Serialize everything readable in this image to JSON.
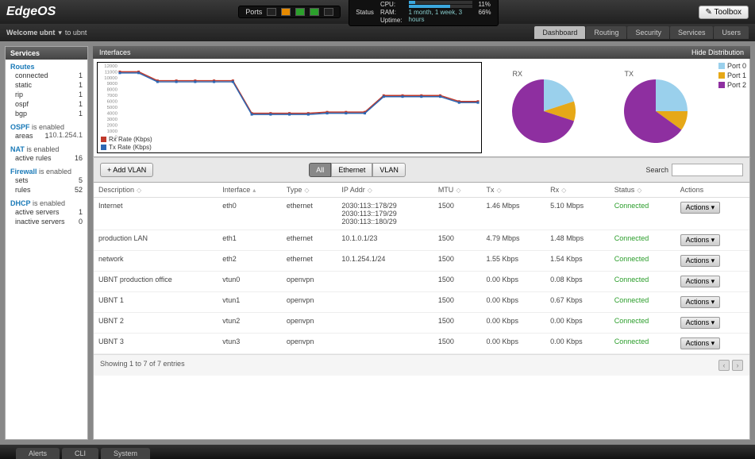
{
  "app": {
    "name": "EdgeOS"
  },
  "topbar": {
    "ports_label": "Ports",
    "status_label": "Status",
    "cpu_label": "CPU:",
    "cpu_pct": 11,
    "cpu_pct_text": "11%",
    "ram_label": "RAM:",
    "ram_pct": 66,
    "ram_pct_text": "66%",
    "uptime_label": "Uptime:",
    "uptime_value": "1 month, 1 week, 3 hours",
    "toolbox_label": "Toolbox"
  },
  "welcome": {
    "text": "Welcome ubnt",
    "sep": "▾",
    "to": "to ubnt"
  },
  "nav_tabs": [
    "Dashboard",
    "Routing",
    "Security",
    "Services",
    "Users"
  ],
  "nav_active": 0,
  "sidebar": {
    "title": "Services",
    "groups": [
      {
        "title": "Routes",
        "title_plain": true,
        "items": [
          {
            "k": "connected",
            "v": "1"
          },
          {
            "k": "static",
            "v": "1"
          },
          {
            "k": "rip",
            "v": "1"
          },
          {
            "k": "ospf",
            "v": "1"
          },
          {
            "k": "bgp",
            "v": "1"
          }
        ]
      },
      {
        "title": "OSPF",
        "suffix": "is enabled",
        "extra": "10.1.254.1",
        "items": [
          {
            "k": "areas",
            "v": "1"
          }
        ]
      },
      {
        "title": "NAT",
        "suffix": "is enabled",
        "items": [
          {
            "k": "active rules",
            "v": "16"
          }
        ]
      },
      {
        "title": "Firewall",
        "suffix": "is enabled",
        "items": [
          {
            "k": "sets",
            "v": "5"
          },
          {
            "k": "rules",
            "v": "52"
          }
        ]
      },
      {
        "title": "DHCP",
        "suffix": "is enabled",
        "items": [
          {
            "k": "active servers",
            "v": "1"
          },
          {
            "k": "inactive servers",
            "v": "0"
          }
        ]
      }
    ]
  },
  "interfaces_hdr": {
    "title": "Interfaces",
    "link": "Hide Distribution"
  },
  "chart_data": {
    "line": {
      "type": "line",
      "title": "",
      "xlabel": "",
      "ylabel": "",
      "ylim": [
        0,
        12000
      ],
      "yticks": [
        0,
        1000,
        2000,
        3000,
        4000,
        5000,
        6000,
        7000,
        8000,
        9000,
        10000,
        11000,
        12000
      ],
      "series": [
        {
          "name": "Rx Rate (Kbps)",
          "color": "#c0392b",
          "values": [
            11000,
            11000,
            9500,
            9500,
            9500,
            9500,
            9500,
            4000,
            4000,
            4000,
            4000,
            4200,
            4200,
            4200,
            7000,
            7000,
            7000,
            7000,
            6000,
            6000
          ]
        },
        {
          "name": "Tx Rate (Kbps)",
          "color": "#2c67b3",
          "values": [
            10800,
            10800,
            9300,
            9300,
            9300,
            9300,
            9300,
            3800,
            3800,
            3800,
            3800,
            4000,
            4000,
            4000,
            6800,
            6800,
            6800,
            6800,
            5800,
            5800
          ]
        }
      ]
    },
    "pies": [
      {
        "type": "pie",
        "title": "RX",
        "series": [
          {
            "name": "Port 0",
            "color": "#9ad0ec",
            "value": 20
          },
          {
            "name": "Port 1",
            "color": "#e6a817",
            "value": 10
          },
          {
            "name": "Port 2",
            "color": "#8e2fa0",
            "value": 70
          }
        ]
      },
      {
        "type": "pie",
        "title": "TX",
        "series": [
          {
            "name": "Port 0",
            "color": "#9ad0ec",
            "value": 25
          },
          {
            "name": "Port 1",
            "color": "#e6a817",
            "value": 10
          },
          {
            "name": "Port 2",
            "color": "#8e2fa0",
            "value": 65
          }
        ]
      }
    ],
    "pie_legend": [
      {
        "name": "Port 0",
        "color": "#9ad0ec"
      },
      {
        "name": "Port 1",
        "color": "#e6a817"
      },
      {
        "name": "Port 2",
        "color": "#8e2fa0"
      }
    ]
  },
  "controls": {
    "add_vlan": "+  Add VLAN",
    "filters": [
      "All",
      "Ethernet",
      "VLAN"
    ],
    "filter_active": 0,
    "search_label": "Search"
  },
  "table": {
    "cols": [
      "Description",
      "Interface",
      "Type",
      "IP Addr",
      "MTU",
      "Tx",
      "Rx",
      "Status",
      "Actions"
    ],
    "rows": [
      {
        "desc": "Internet",
        "if": "eth0",
        "type": "ethernet",
        "ip": "2030:113::178/29\n2030:113::179/29\n2030:113::180/29",
        "mtu": "1500",
        "tx": "1.46 Mbps",
        "rx": "5.10 Mbps",
        "status": "Connected"
      },
      {
        "desc": "production LAN",
        "if": "eth1",
        "type": "ethernet",
        "ip": "10.1.0.1/23",
        "mtu": "1500",
        "tx": "4.79 Mbps",
        "rx": "1.48 Mbps",
        "status": "Connected"
      },
      {
        "desc": "network",
        "if": "eth2",
        "type": "ethernet",
        "ip": "10.1.254.1/24",
        "mtu": "1500",
        "tx": "1.55 Kbps",
        "rx": "1.54 Kbps",
        "status": "Connected"
      },
      {
        "desc": "UBNT production office",
        "if": "vtun0",
        "type": "openvpn",
        "ip": "",
        "mtu": "1500",
        "tx": "0.00 Kbps",
        "rx": "0.08 Kbps",
        "status": "Connected"
      },
      {
        "desc": "UBNT 1",
        "if": "vtun1",
        "type": "openvpn",
        "ip": "",
        "mtu": "1500",
        "tx": "0.00 Kbps",
        "rx": "0.67 Kbps",
        "status": "Connected"
      },
      {
        "desc": "UBNT 2",
        "if": "vtun2",
        "type": "openvpn",
        "ip": "",
        "mtu": "1500",
        "tx": "0.00 Kbps",
        "rx": "0.00 Kbps",
        "status": "Connected"
      },
      {
        "desc": "UBNT 3",
        "if": "vtun3",
        "type": "openvpn",
        "ip": "",
        "mtu": "1500",
        "tx": "0.00 Kbps",
        "rx": "0.00 Kbps",
        "status": "Connected"
      }
    ],
    "actions_label": "Actions  ▾",
    "footer": "Showing 1 to 7 of 7 entries"
  },
  "footer_tabs": [
    "Alerts",
    "CLI",
    "System"
  ]
}
